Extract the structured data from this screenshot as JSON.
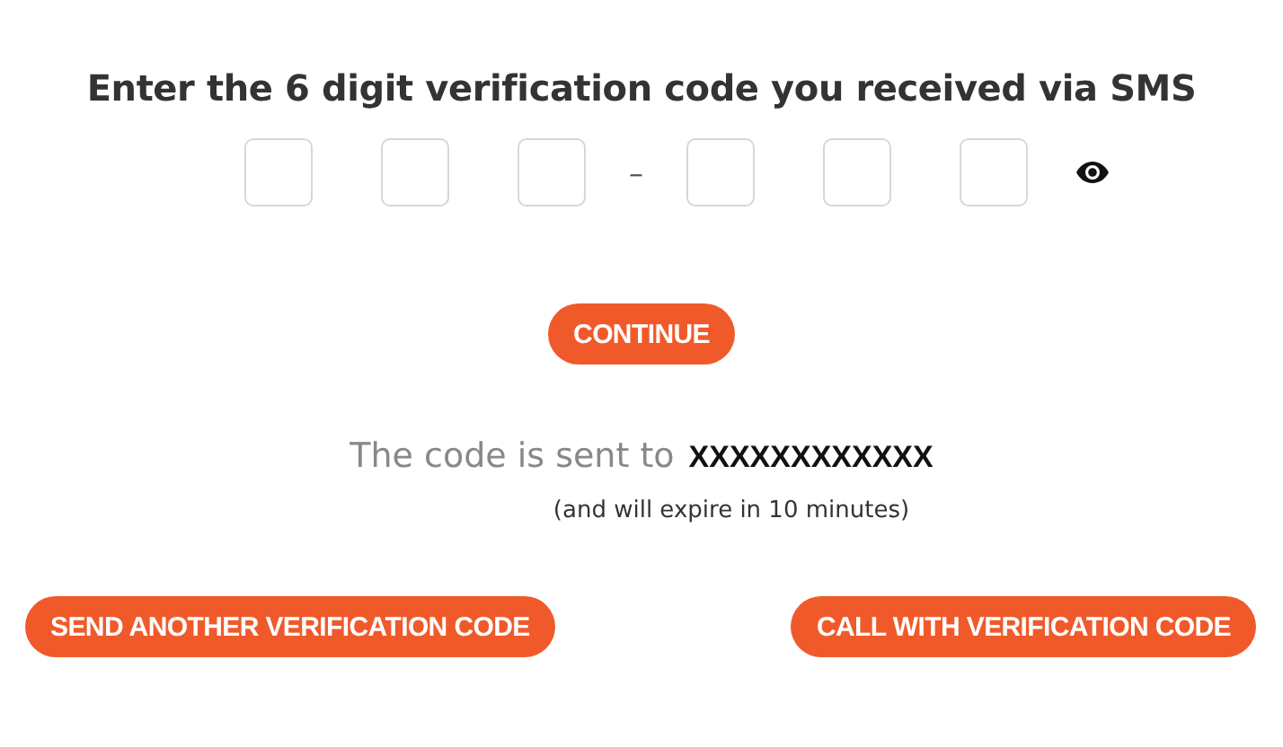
{
  "heading": "Enter the 6 digit verification code you received via SMS",
  "code_inputs": [
    {
      "kind": "digit"
    },
    {
      "kind": "digit"
    },
    {
      "kind": "digit"
    },
    {
      "kind": "separator",
      "text": "–"
    },
    {
      "kind": "digit"
    },
    {
      "kind": "digit"
    },
    {
      "kind": "digit"
    }
  ],
  "continue_button": "CONTINUE",
  "sent_to": {
    "label": "The code is sent to",
    "number": "XXXXXXXXXXXX"
  },
  "expiry_note": "(and will expire in 10 minutes)",
  "actions": [
    "SEND ANOTHER VERIFICATION CODE",
    "CALL WITH VERIFICATION CODE"
  ]
}
